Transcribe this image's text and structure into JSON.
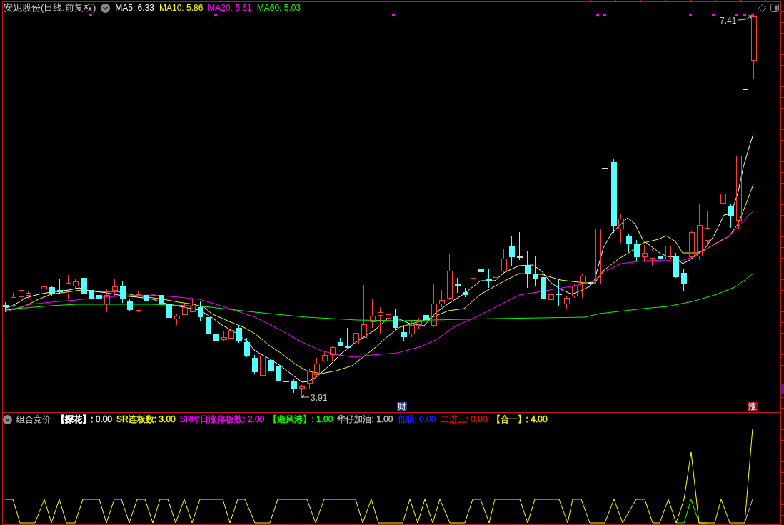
{
  "header": {
    "title": "安妮股份(日线.前复权)",
    "moving_averages": [
      {
        "text": "MA5: 6.33",
        "color": "#ffffff"
      },
      {
        "text": "MA10: 5.86",
        "color": "#ffff00"
      },
      {
        "text": "MA20: 5.61",
        "color": "#ff00ff"
      },
      {
        "text": "MA60: 5.03",
        "color": "#00ff00"
      }
    ]
  },
  "price_chart": {
    "high_label": "7.41",
    "low_label": "3.91",
    "event_markers": [
      {
        "text": "财",
        "kind": "finance"
      },
      {
        "text": "涨",
        "kind": "limit_up"
      }
    ]
  },
  "indicator_panel": {
    "title": "组合竞价",
    "values": [
      {
        "text": "**【探花】**: 0.00",
        "color": "#ffffff"
      },
      {
        "text": "SR连板数: 3.00",
        "color": "#ffff00"
      },
      {
        "text": "SR昨日涨停板数: 2.00",
        "color": "#ff00ff"
      },
      {
        "text": "【避风港】: 1.00",
        "color": "#00ff00"
      },
      {
        "text": "华仔加油: 1.00",
        "color": "#c0c0c0"
      },
      {
        "text": "低吸: 0.00",
        "color": "#2020ff"
      },
      {
        "text": "二进三: 0.00",
        "color": "#ff0000"
      },
      {
        "text": "【合一】: 4.00",
        "color": "#ffff00"
      }
    ]
  }
}
